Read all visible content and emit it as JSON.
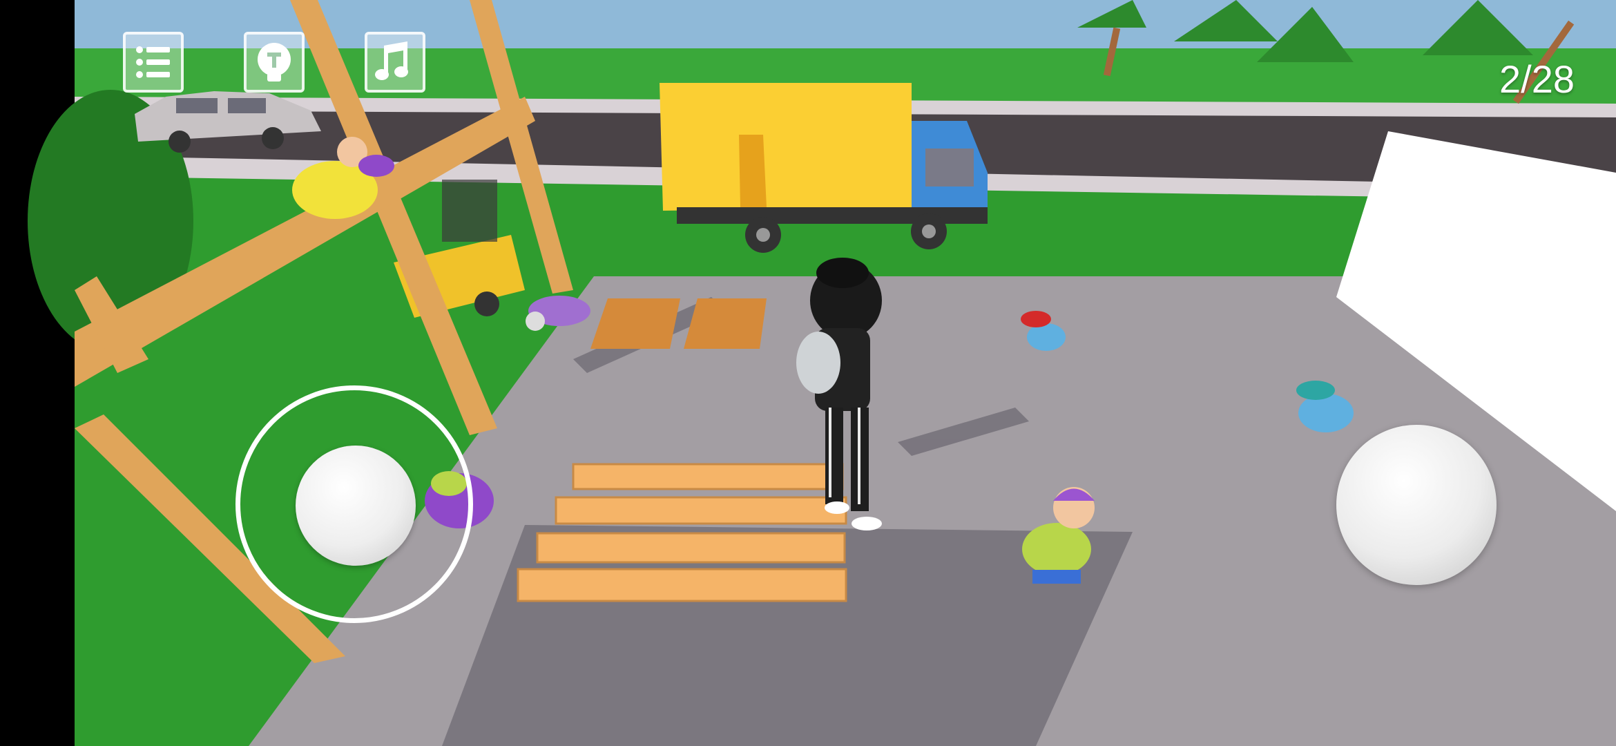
{
  "hud": {
    "level_counter": "2/28",
    "buttons": [
      {
        "name": "levels-menu-button",
        "icon": "list-icon"
      },
      {
        "name": "hint-button",
        "icon": "lightbulb-hint-icon"
      },
      {
        "name": "music-toggle-button",
        "icon": "music-note-icon"
      }
    ]
  },
  "controls": {
    "joystick": "virtual-joystick",
    "action": "action-button"
  },
  "colors": {
    "sky": "#8fb9d8",
    "grass": "#2f9c2f",
    "road": "#4a4347",
    "concrete": "#a39ea3",
    "truck_box": "#fbcf33",
    "truck_cab": "#3f8bd6",
    "plank": "#f5b468"
  }
}
